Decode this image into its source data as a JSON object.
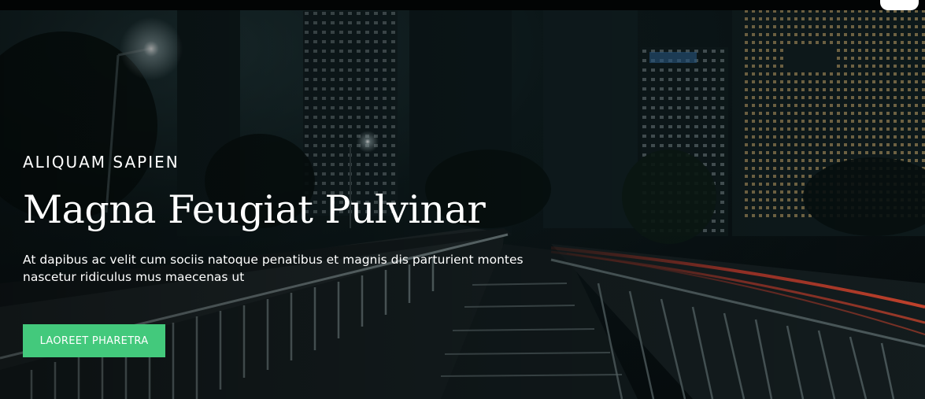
{
  "hero": {
    "eyebrow": "ALIQUAM SAPIEN",
    "title": "Magna Feugiat Pulvinar",
    "description": "At dapibus ac velit cum sociis natoque penatibus et magnis dis parturient montes nascetur ridiculus mus maecenas ut",
    "button_label": "LAOREET PHARETRA"
  },
  "colors": {
    "accent": "#43c97c",
    "text": "#ffffff",
    "background": "#0b1416",
    "light_trail": "#c0392b"
  },
  "icons": {
    "background_image": "night-city-highway-photo"
  }
}
